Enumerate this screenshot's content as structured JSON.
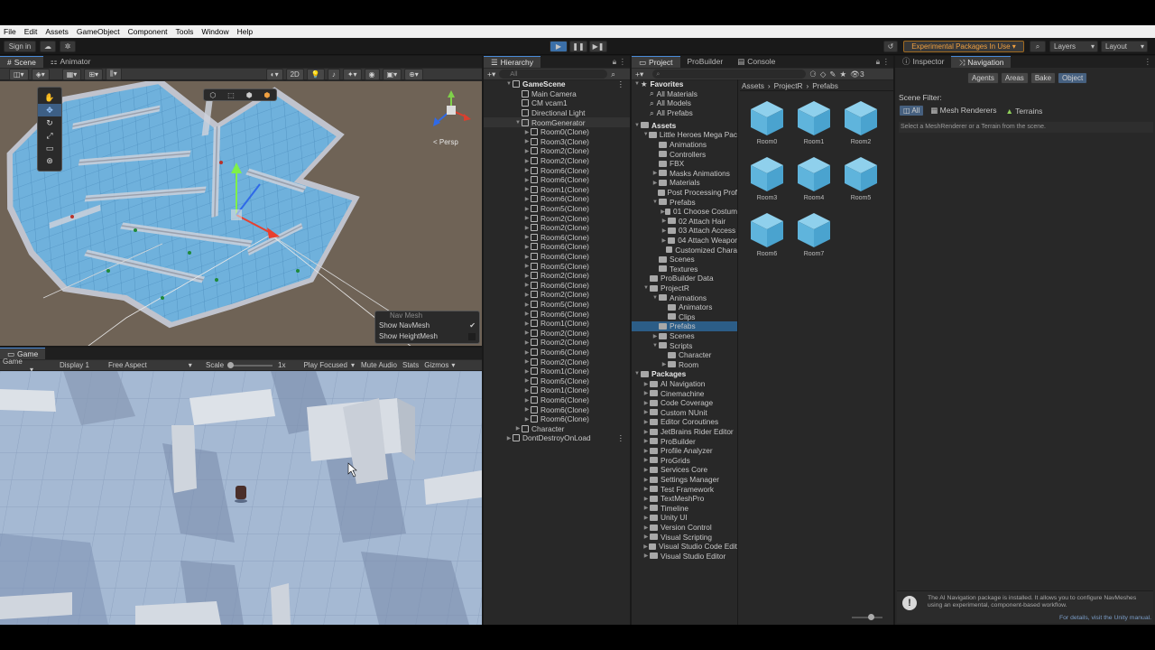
{
  "menu": [
    "File",
    "Edit",
    "Assets",
    "GameObject",
    "Component",
    "Tools",
    "Window",
    "Help"
  ],
  "toolbar": {
    "signin": "Sign in",
    "experimental": "Experimental Packages In Use ▾",
    "layers": "Layers",
    "layout": "Layout"
  },
  "scene_tabs": {
    "scene": "Scene",
    "animator": "Animator"
  },
  "scene_toolbar": {
    "mode2d": "2D",
    "persp": "< Persp"
  },
  "navmesh_overlay": {
    "title": "Nav Mesh",
    "show_navmesh": "Show NavMesh",
    "show_heightmesh": "Show HeightMesh"
  },
  "game_tab": "Game",
  "game_toolbar": {
    "game": "Game",
    "display": "Display 1",
    "aspect": "Free Aspect",
    "scale": "Scale",
    "scale_val": "1x",
    "play_focused": "Play Focused",
    "mute": "Mute Audio",
    "stats": "Stats",
    "gizmos": "Gizmos"
  },
  "hierarchy": {
    "tab": "Hierarchy",
    "search_placeholder": "All",
    "scene": "GameScene",
    "items": [
      "Main Camera",
      "CM vcam1",
      "Directional Light"
    ],
    "generator": "RoomGenerator",
    "rooms": [
      "Room0(Clone)",
      "Room3(Clone)",
      "Room2(Clone)",
      "Room2(Clone)",
      "Room6(Clone)",
      "Room6(Clone)",
      "Room1(Clone)",
      "Room6(Clone)",
      "Room5(Clone)",
      "Room2(Clone)",
      "Room2(Clone)",
      "Room6(Clone)",
      "Room6(Clone)",
      "Room6(Clone)",
      "Room5(Clone)",
      "Room2(Clone)",
      "Room6(Clone)",
      "Room2(Clone)",
      "Room5(Clone)",
      "Room6(Clone)",
      "Room1(Clone)",
      "Room2(Clone)",
      "Room2(Clone)",
      "Room6(Clone)",
      "Room2(Clone)",
      "Room1(Clone)",
      "Room5(Clone)",
      "Room1(Clone)",
      "Room6(Clone)",
      "Room6(Clone)",
      "Room6(Clone)"
    ],
    "character": "Character",
    "dontdestroy": "DontDestroyOnLoad"
  },
  "project": {
    "tabs": [
      "Project",
      "ProBuilder",
      "Console"
    ],
    "badge": "3",
    "breadcrumb": [
      "Assets",
      "ProjectR",
      "Prefabs"
    ],
    "favorites_label": "Favorites",
    "favorites": [
      "All Materials",
      "All Models",
      "All Prefabs"
    ],
    "assets_label": "Assets",
    "tree": [
      {
        "d": 1,
        "t": "Little Heroes Mega Pac",
        "o": true
      },
      {
        "d": 2,
        "t": "Animations"
      },
      {
        "d": 2,
        "t": "Controllers"
      },
      {
        "d": 2,
        "t": "FBX"
      },
      {
        "d": 2,
        "t": "Masks Animations",
        "a": true
      },
      {
        "d": 2,
        "t": "Materials",
        "a": true
      },
      {
        "d": 2,
        "t": "Post Processing Prof"
      },
      {
        "d": 2,
        "t": "Prefabs",
        "o": true
      },
      {
        "d": 3,
        "t": "01 Choose Costum",
        "a": true
      },
      {
        "d": 3,
        "t": "02 Attach Hair",
        "a": true
      },
      {
        "d": 3,
        "t": "03 Attach Access",
        "a": true
      },
      {
        "d": 3,
        "t": "04 Attach Weapor",
        "a": true
      },
      {
        "d": 3,
        "t": "Customized Chara"
      },
      {
        "d": 2,
        "t": "Scenes"
      },
      {
        "d": 2,
        "t": "Textures"
      },
      {
        "d": 1,
        "t": "ProBuilder Data"
      },
      {
        "d": 1,
        "t": "ProjectR",
        "o": true
      },
      {
        "d": 2,
        "t": "Animations",
        "o": true
      },
      {
        "d": 3,
        "t": "Animators"
      },
      {
        "d": 3,
        "t": "Clips"
      },
      {
        "d": 2,
        "t": "Prefabs",
        "s": true
      },
      {
        "d": 2,
        "t": "Scenes",
        "a": true
      },
      {
        "d": 2,
        "t": "Scripts",
        "o": true
      },
      {
        "d": 3,
        "t": "Character"
      },
      {
        "d": 3,
        "t": "Room",
        "a": true
      }
    ],
    "packages_label": "Packages",
    "packages": [
      "AI Navigation",
      "Cinemachine",
      "Code Coverage",
      "Custom NUnit",
      "Editor Coroutines",
      "JetBrains Rider Editor",
      "ProBuilder",
      "Profile Analyzer",
      "ProGrids",
      "Services Core",
      "Settings Manager",
      "Test Framework",
      "TextMeshPro",
      "Timeline",
      "Unity UI",
      "Version Control",
      "Visual Scripting",
      "Visual Studio Code Edit",
      "Visual Studio Editor"
    ],
    "prefabs": [
      "Room0",
      "Room1",
      "Room2",
      "Room3",
      "Room4",
      "Room5",
      "Room6",
      "Room7"
    ]
  },
  "inspector": {
    "tabs": [
      "Inspector",
      "Navigation"
    ],
    "nav_buttons": [
      "Agents",
      "Areas",
      "Bake",
      "Object"
    ],
    "scene_filter": "Scene Filter:",
    "filters": [
      "All",
      "Mesh Renderers",
      "Terrains"
    ],
    "hint": "Select a MeshRenderer or a Terrain from the scene.",
    "info": "The AI Navigation package is installed. It allows you to configure NavMeshes using an experimental, component-based workflow.",
    "link": "For details, visit the Unity manual."
  }
}
